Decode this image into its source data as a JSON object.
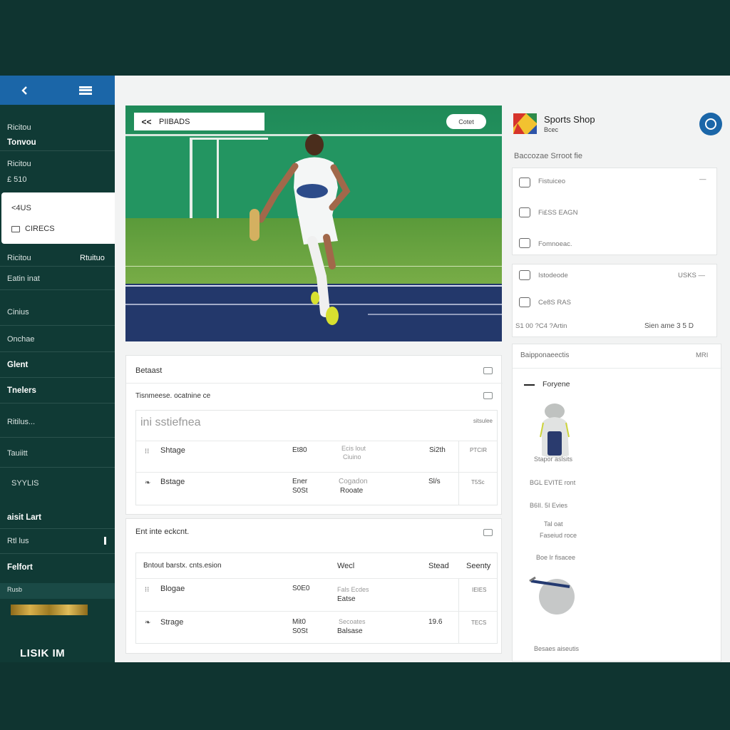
{
  "sidebar": {
    "items": [
      {
        "label": "Ricitou"
      },
      {
        "label": "Tonvou"
      },
      {
        "label": "Ricitou"
      },
      {
        "label": "£ 510"
      },
      {
        "label": "Ricitou",
        "right": "Rtuituo"
      },
      {
        "label": "Eatin inat"
      },
      {
        "label": "Cinius"
      },
      {
        "label": "Onchae"
      },
      {
        "label": "Glent"
      },
      {
        "label": "Tnelers"
      },
      {
        "label": "Ritilus..."
      },
      {
        "label": "Tauiitt"
      },
      {
        "label": "SYYLIS"
      },
      {
        "label": "aisit Lart"
      },
      {
        "label": "Rtl lus"
      },
      {
        "label": "Felfort"
      },
      {
        "label": "Rusb"
      }
    ],
    "card_rows": [
      "<4US",
      "CIRECS"
    ],
    "bottom_label": "LISIK IM"
  },
  "hero": {
    "tab_label": "PIIBADS",
    "back_glyph": "<<",
    "button_label": "Cotet"
  },
  "table1": {
    "header": "Betaast",
    "subheader": "Tisnmeese. ocatnine ce",
    "search_placeholder": "ini sstiefnea",
    "search_hint": "sitsulee",
    "rows": [
      {
        "name": "Shtage",
        "c1": "Et80",
        "c2a": "Ecis lout",
        "c2b": "Ciuino",
        "c3": "Si2th",
        "c4": "PTCIR"
      },
      {
        "name": "Bstage",
        "c1": "Ener",
        "c1b": "S0St",
        "c2a": "Cogadon",
        "c2b": "Rooate",
        "c3": "Sl/s",
        "c4": "T5Sc"
      }
    ]
  },
  "table2": {
    "header": "Ent inte eckcnt.",
    "columns": [
      "Bntout barstx. cnts.esion",
      "Wecl",
      "Stead",
      "Seenty"
    ],
    "rows": [
      {
        "name": "Blogae",
        "c1": "S0E0",
        "c2a": "Fals Ecdes",
        "c2b": "Eatse",
        "c4": "IEIES"
      },
      {
        "name": "Strage",
        "c1": "Mit0",
        "c1b": "S0St",
        "c2a": "Secoates",
        "c2b": "Balsase",
        "c3": "19.6",
        "c4": "TECS"
      }
    ]
  },
  "right_panel": {
    "brand": "Sports Shop",
    "brand_sub": "Bcec",
    "section_label": "Baccozae Srroot fie",
    "list1": [
      {
        "label": "Fistuiceo",
        "right": "—"
      },
      {
        "label": "Fi£SS EAGN"
      },
      {
        "label": "Fomnoeac."
      }
    ],
    "list2": [
      {
        "label": "Istodeode",
        "right": "USKS —"
      },
      {
        "label": "Ce8S RAS"
      }
    ],
    "footer_left": "S1 00 ?C4 ?Artin",
    "footer_right": "Sien ame 3 5 D",
    "products_header": "Baipponaeectis",
    "products_header_right": "MRI",
    "product_tab": "Foryene",
    "product_texts": [
      "Stapor aslsits",
      "BGL EVITE ront",
      "B6II. 5I Evies",
      "Tal oat",
      "Faseiud roce",
      "Boe Ir fisacee",
      "Besaes aiseutis"
    ]
  },
  "colors": {
    "background": "#0f3430",
    "sidebar": "#103a35",
    "accent": "#1b66a8",
    "panel": "#f2f3f3"
  }
}
